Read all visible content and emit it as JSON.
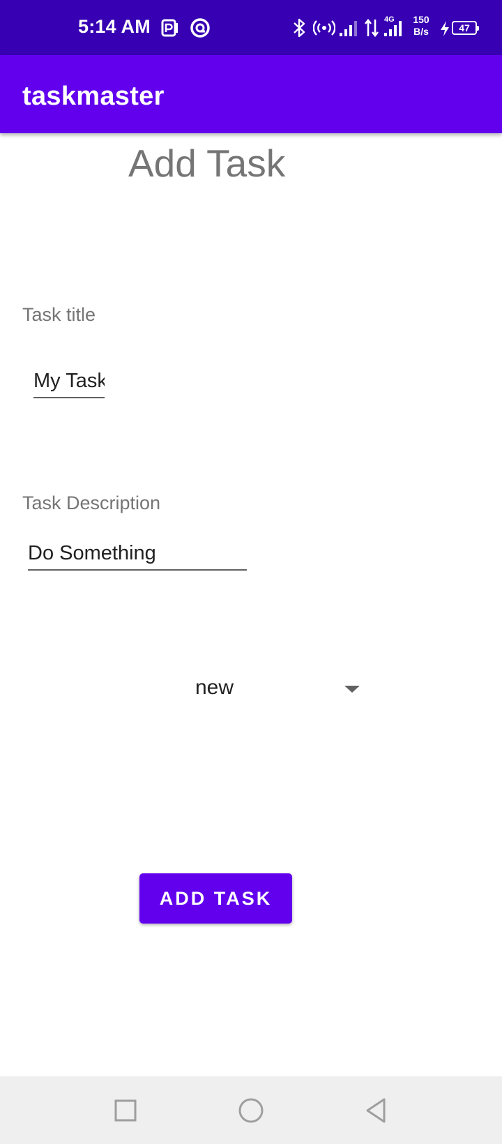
{
  "status_bar": {
    "time": "5:14 AM",
    "net_speed_value": "150",
    "net_speed_unit": "B/s",
    "battery_level": "47",
    "network_type": "4G",
    "icons": [
      "parking-app-icon",
      "vpn-icon",
      "bluetooth-icon",
      "hotspot-icon",
      "signal-icon",
      "data-arrows-icon",
      "signal-4g-icon",
      "charging-icon",
      "battery-icon"
    ],
    "background": "#3700b3"
  },
  "app_bar": {
    "title": "taskmaster",
    "color": "#6200ee"
  },
  "page": {
    "heading": "Add Task"
  },
  "form": {
    "title_label": "Task title",
    "title_value": "My Task",
    "description_label": "Task Description",
    "description_value": "Do Something",
    "status_selected": "new"
  },
  "actions": {
    "add_button_label": "ADD TASK",
    "accent": "#6200ee"
  },
  "nav_bar": {
    "icons": [
      "recents-square-icon",
      "home-circle-icon",
      "back-triangle-icon"
    ]
  }
}
